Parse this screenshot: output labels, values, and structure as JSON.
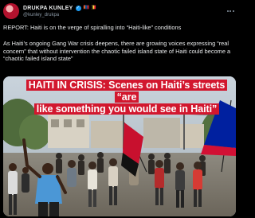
{
  "post": {
    "author": {
      "display_name": "DRUKPA KUNLEY",
      "emoji_flags": "🇲🇳 🇧🇪",
      "handle": "@kunley_drukpa",
      "avatar_icon": "profile-avatar"
    },
    "paragraph_1": "REPORT: Haiti is on the verge of spiralling into “Haiti-like” conditions",
    "paragraph_2": "As Haiti’s ongoing Gang War crisis deepens, there are growing voices expressing “real concern” that without intervention the chaotic failed island state of Haiti could become a “chaotic failed island state”",
    "media": {
      "headline_line_1": "HAITI IN CRISIS: Scenes on Haiti’s streets “are",
      "headline_line_2": "like something you would see in Haiti”"
    },
    "more_icon": "ellipsis-icon"
  },
  "colors": {
    "background": "#000000",
    "text": "#e7e9ea",
    "muted": "#8b98a5",
    "verified": "#1d9bf0",
    "headline_bg": "#d2172e"
  }
}
